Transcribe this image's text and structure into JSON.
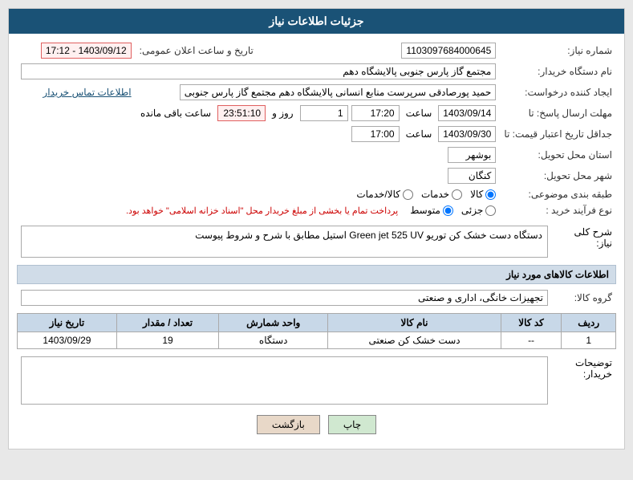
{
  "header": {
    "title": "جزئیات اطلاعات نیاز"
  },
  "fields": {
    "shomareNiaz_label": "شماره نیاز:",
    "shomareNiaz_value": "1103097684000645",
    "namDastgah_label": "نام دستگاه خریدار:",
    "namDastgah_value": "مجتمع گاز پارس جنوبی  پالایشگاه دهم",
    "ijadKonande_label": "ایجاد کننده درخواست:",
    "ijadKonande_value": "حمید پورصادقی سرپرست منابع انسانی پالایشگاه دهم  مجتمع گاز پارس جنوبی",
    "ettelaat_link": "اطلاعات تماس خریدار",
    "tarikhEelan_label": "تاریخ و ساعت اعلان عمومی:",
    "tarikhEelan_value": "1403/09/12 - 17:12",
    "mohlat_label": "مهلت ارسال پاسخ: تا",
    "mohlat_date": "1403/09/14",
    "mohlat_saat": "17:20",
    "mohlat_roz": "1",
    "mohlat_baghimande": "23:51:10",
    "jadaval_label": "جداقل تاریخ اعتبار قیمت: تا",
    "jadaval_date": "1403/09/30",
    "jadaval_saat": "17:00",
    "ostan_label": "استان محل تحویل:",
    "ostan_value": "بوشهر",
    "shahr_label": "شهر محل تحویل:",
    "shahr_value": "کنگان",
    "tabaqe_label": "طبقه بندی موضوعی:",
    "tabaqe_kala": "کالا",
    "tabaqe_khadamat": "خدمات",
    "tabaqe_kala_khadamat": "کالا/خدمات",
    "noFaravand_label": "نوع فرآیند خرید :",
    "noFaravand_jozii": "جزئی",
    "noFaravand_motavaset": "متوسط",
    "noFaravand_note": "پرداخت تمام یا بخشی از مبلغ خریدار محل \"اسناد خزانه اسلامی\" خواهد بود.",
    "sherh_label": "شرح کلی نیاز:",
    "sherh_value": "دستگاه دست خشک کن توریو Green jet 525 UV  استیل مطابق با شرح و شروط پیوست",
    "kalaSection_label": "اطلاعات کالاهای مورد نیاز",
    "groupKala_label": "گروه کالا:",
    "groupKala_value": "تجهیزات خانگی، اداری و صنعتی",
    "table": {
      "headers": [
        "ردیف",
        "کد کالا",
        "نام کالا",
        "واحد شمارش",
        "تعداد / مقدار",
        "تاریخ نیاز"
      ],
      "rows": [
        {
          "radif": "1",
          "kod": "--",
          "name": "دست خشک کن صنعتی",
          "vahed": "دستگاه",
          "tedad": "19",
          "tarikh": "1403/09/29"
        }
      ]
    },
    "tawzih_label": "توضیحات خریدار:",
    "btn_chap": "چاپ",
    "btn_bazgasht": "بازگشت",
    "saat_label": "ساعت",
    "roz_label": "روز و",
    "baghimande_label": "ساعت باقی مانده"
  }
}
